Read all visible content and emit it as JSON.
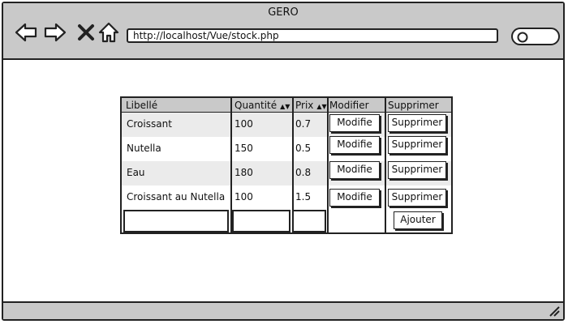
{
  "window": {
    "title": "GERO"
  },
  "toolbar": {
    "url": "http://localhost/Vue/stock.php",
    "icons": [
      "back-arrow-icon",
      "forward-arrow-icon",
      "close-icon",
      "home-icon",
      "search-icon"
    ]
  },
  "table": {
    "columns": [
      {
        "label": "Libellé",
        "sortable": false
      },
      {
        "label": "Quantité",
        "sortable": true
      },
      {
        "label": "Prix",
        "sortable": true
      },
      {
        "label": "Modifier",
        "sortable": false
      },
      {
        "label": "Supprimer",
        "sortable": false
      }
    ],
    "rows": [
      {
        "libelle": "Croissant",
        "quantite": "100",
        "prix": "0.7",
        "modifier": "Modifie",
        "supprimer": "Supprimer"
      },
      {
        "libelle": "Nutella",
        "quantite": "150",
        "prix": "0.5",
        "modifier": "Modifie",
        "supprimer": "Supprimer"
      },
      {
        "libelle": "Eau",
        "quantite": "180",
        "prix": "0.8",
        "modifier": "Modifie",
        "supprimer": "Supprimer"
      },
      {
        "libelle": "Croissant au Nutella",
        "quantite": "100",
        "prix": "1.5",
        "modifier": "Modifie",
        "supprimer": "Supprimer"
      }
    ],
    "add_row": {
      "libelle": "",
      "quantite": "",
      "prix": "",
      "add_label": "Ajouter"
    }
  }
}
